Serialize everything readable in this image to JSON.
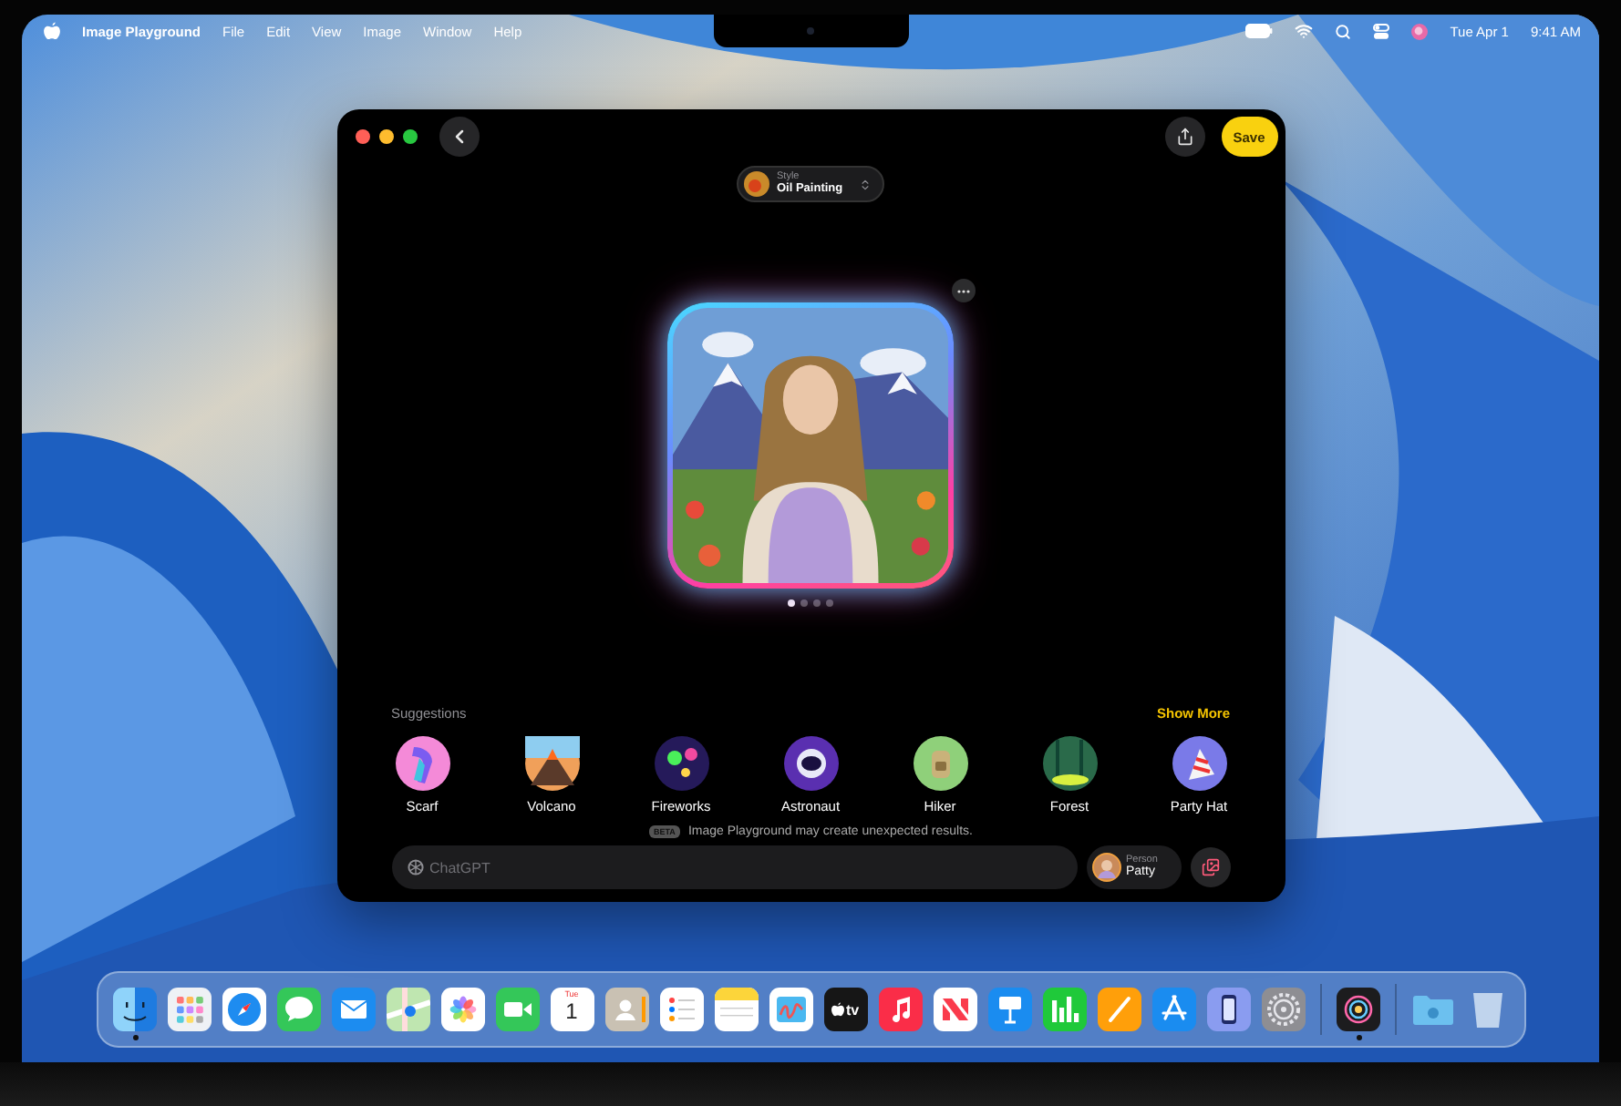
{
  "menu_bar": {
    "app_name": "Image Playground",
    "menus": [
      "File",
      "Edit",
      "View",
      "Image",
      "Window",
      "Help"
    ],
    "date": "Tue Apr 1",
    "time": "9:41 AM"
  },
  "window": {
    "save_button": "Save",
    "style": {
      "label": "Style",
      "value": "Oil Painting"
    },
    "image_pages": [
      {
        "selected": true
      },
      {
        "selected": false
      },
      {
        "selected": false
      },
      {
        "selected": false
      }
    ],
    "suggestions_title": "Suggestions",
    "show_more": "Show More",
    "suggestions": [
      {
        "kind": "scarf",
        "label": "Scarf"
      },
      {
        "kind": "volcano",
        "label": "Volcano"
      },
      {
        "kind": "fireworks",
        "label": "Fireworks"
      },
      {
        "kind": "astronaut",
        "label": "Astronaut"
      },
      {
        "kind": "hiker",
        "label": "Hiker"
      },
      {
        "kind": "forest",
        "label": "Forest"
      },
      {
        "kind": "party_hat",
        "label": "Party Hat"
      }
    ],
    "beta_badge": "BETA",
    "notice": "Image Playground may create unexpected results.",
    "prompt": {
      "placeholder": "ChatGPT"
    },
    "person": {
      "label": "Person",
      "name": "Patty"
    }
  },
  "dock": {
    "groups": [
      [
        {
          "kind": "finder",
          "running": true
        },
        {
          "kind": "launchpad",
          "running": false
        },
        {
          "kind": "safari",
          "running": false
        },
        {
          "kind": "messages",
          "running": false
        },
        {
          "kind": "mail",
          "running": false
        },
        {
          "kind": "maps",
          "running": false
        },
        {
          "kind": "photos",
          "running": false
        },
        {
          "kind": "facetime",
          "running": false
        },
        {
          "kind": "calendar",
          "weekday": "Tue",
          "day": "1",
          "running": false
        },
        {
          "kind": "contacts",
          "running": false
        },
        {
          "kind": "reminders",
          "running": false
        },
        {
          "kind": "notes",
          "running": false
        },
        {
          "kind": "freeform",
          "running": false
        },
        {
          "kind": "tv",
          "label": "tv",
          "running": false
        },
        {
          "kind": "music",
          "running": false
        },
        {
          "kind": "news",
          "running": false
        },
        {
          "kind": "keynote",
          "running": false
        },
        {
          "kind": "numbers",
          "running": false
        },
        {
          "kind": "pages",
          "running": false
        },
        {
          "kind": "appstore",
          "running": false
        },
        {
          "kind": "mirroring",
          "running": false
        },
        {
          "kind": "settings",
          "running": false
        }
      ],
      [
        {
          "kind": "playground",
          "running": true
        }
      ],
      [
        {
          "kind": "downloads",
          "running": false
        },
        {
          "kind": "trash",
          "running": false
        }
      ]
    ]
  }
}
